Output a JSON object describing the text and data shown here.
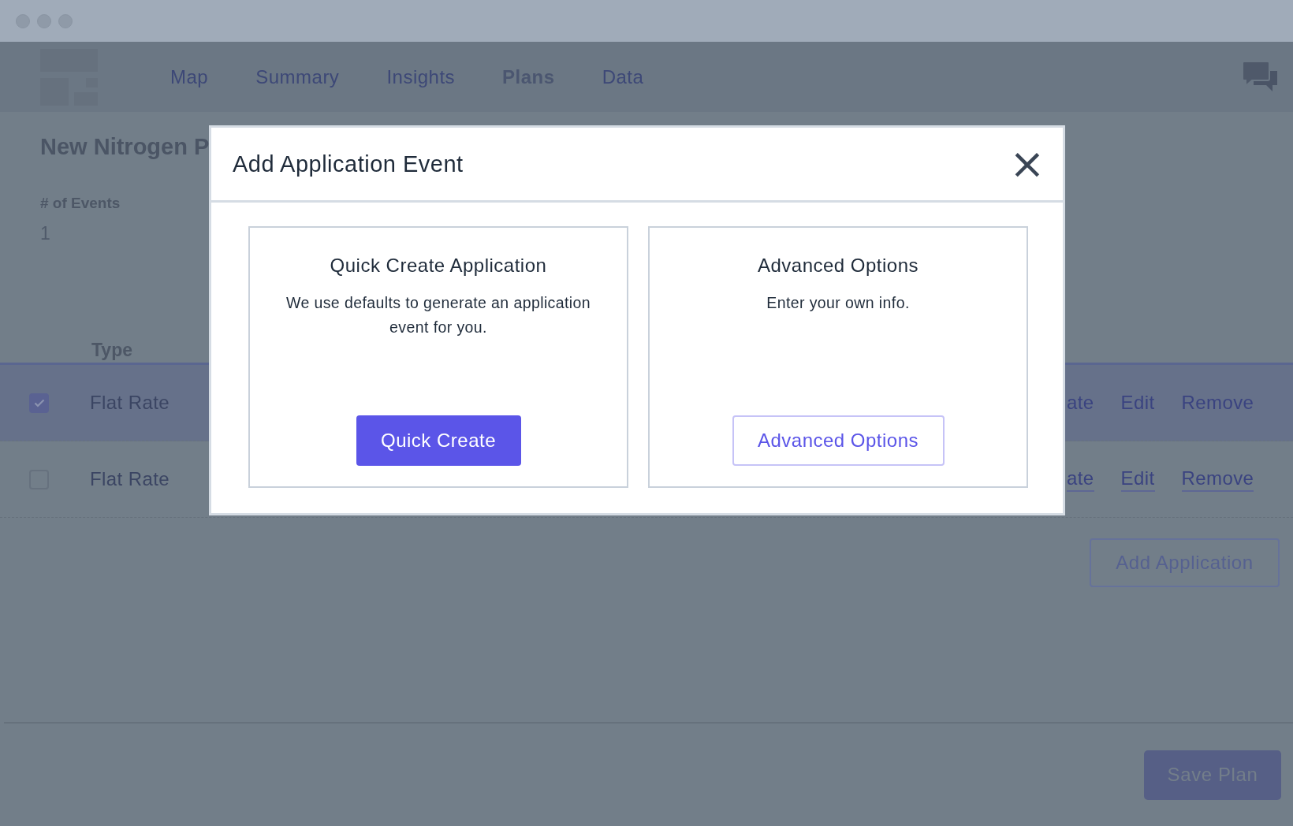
{
  "nav": {
    "tabs": [
      {
        "label": "Map",
        "selected": false
      },
      {
        "label": "Summary",
        "selected": false
      },
      {
        "label": "Insights",
        "selected": false
      },
      {
        "label": "Plans",
        "selected": true
      },
      {
        "label": "Data",
        "selected": false
      }
    ]
  },
  "page": {
    "title": "New Nitrogen P",
    "stats": [
      {
        "label": "# of Events",
        "value": "1"
      }
    ],
    "table": {
      "columns": [
        "Type"
      ],
      "rows": [
        {
          "checked": true,
          "selected": true,
          "type": "Flat Rate",
          "actions": [
            "ate",
            "Edit",
            "Remove"
          ]
        },
        {
          "checked": false,
          "selected": false,
          "type": "Flat Rate",
          "actions": [
            "ate",
            "Edit",
            "Remove"
          ]
        }
      ]
    },
    "add_button": "Add Application",
    "save_button": "Save Plan"
  },
  "modal": {
    "title": "Add Application Event",
    "close": "×",
    "options": [
      {
        "kind": "primary",
        "title": "Quick Create Application",
        "description": "We use defaults to generate an application event for you.",
        "button": "Quick Create"
      },
      {
        "kind": "outline",
        "title": "Advanced Options",
        "description": "Enter your own info.",
        "button": "Advanced Options"
      }
    ]
  }
}
